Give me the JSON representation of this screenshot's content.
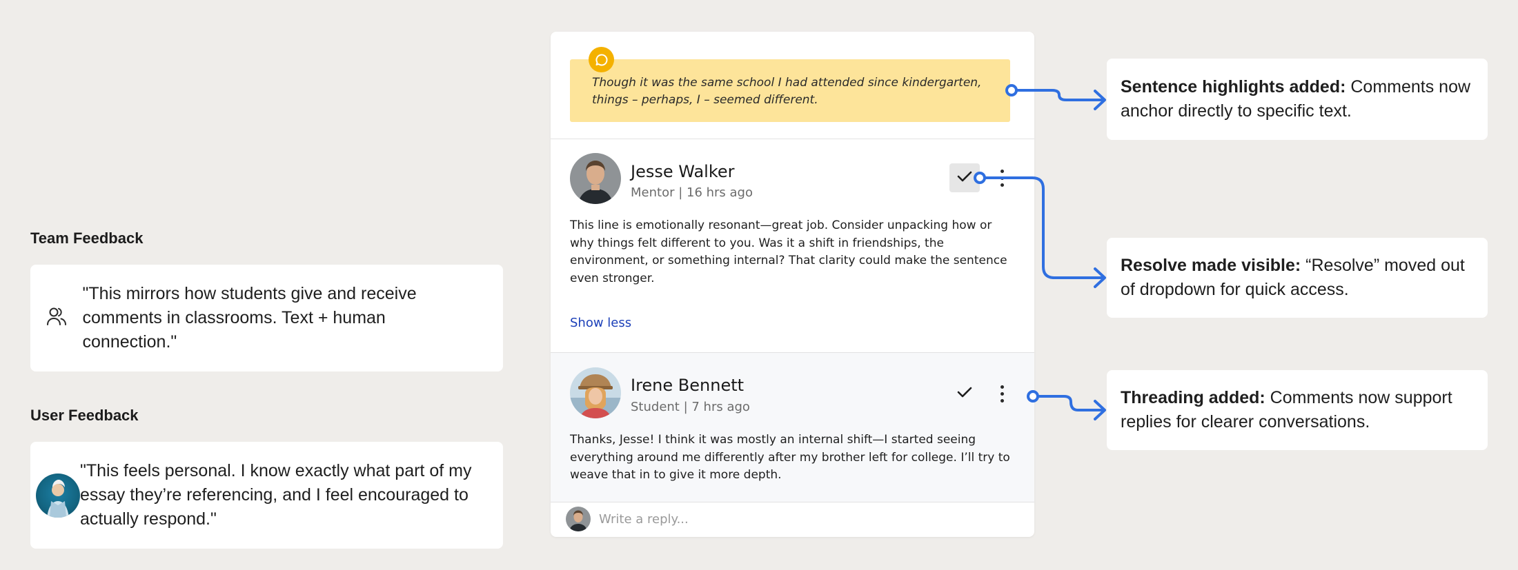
{
  "team_feedback": {
    "title": "Team Feedback",
    "quote": "\"This mirrors how students give and receive comments in classrooms. Text + human connection.\"",
    "icon": "users-icon"
  },
  "user_feedback": {
    "title": "User Feedback",
    "quote": "\"This feels personal. I know exactly what part of my essay they’re referencing, and I feel encouraged to actually respond.\""
  },
  "highlight": {
    "text": "Though it was the same school I had attended since kindergarten, things – perhaps, I – seemed different.",
    "icon": "comment-bubble-icon",
    "color": "#fde49a",
    "badge_color": "#f4b100"
  },
  "comments": [
    {
      "name": "Jesse Walker",
      "meta": "Mentor | 16 hrs ago",
      "body": "This line is emotionally resonant—great job. Consider unpacking how or why things felt different to you. Was it a shift in friendships, the environment, or something internal? That clarity could make the sentence even stronger.",
      "toggle": "Show less"
    },
    {
      "name": "Irene Bennett",
      "meta": "Student | 7 hrs ago",
      "body": "Thanks, Jesse! I think it was mostly an internal shift—I started seeing everything around me differently after my brother left for college. I’ll try to weave that in to give it more depth."
    }
  ],
  "reply": {
    "placeholder": "Write a reply..."
  },
  "annotations": [
    {
      "bold": "Sentence highlights added:",
      "text": " Comments now anchor directly to specific text."
    },
    {
      "bold": "Resolve made visible:",
      "text": " “Resolve” moved out of dropdown for quick access."
    },
    {
      "bold": "Threading added:",
      "text": " Comments now support replies for clearer conversations."
    }
  ],
  "colors": {
    "accent": "#2f6fe0",
    "link": "#1b3fb8",
    "background": "#efedea"
  }
}
